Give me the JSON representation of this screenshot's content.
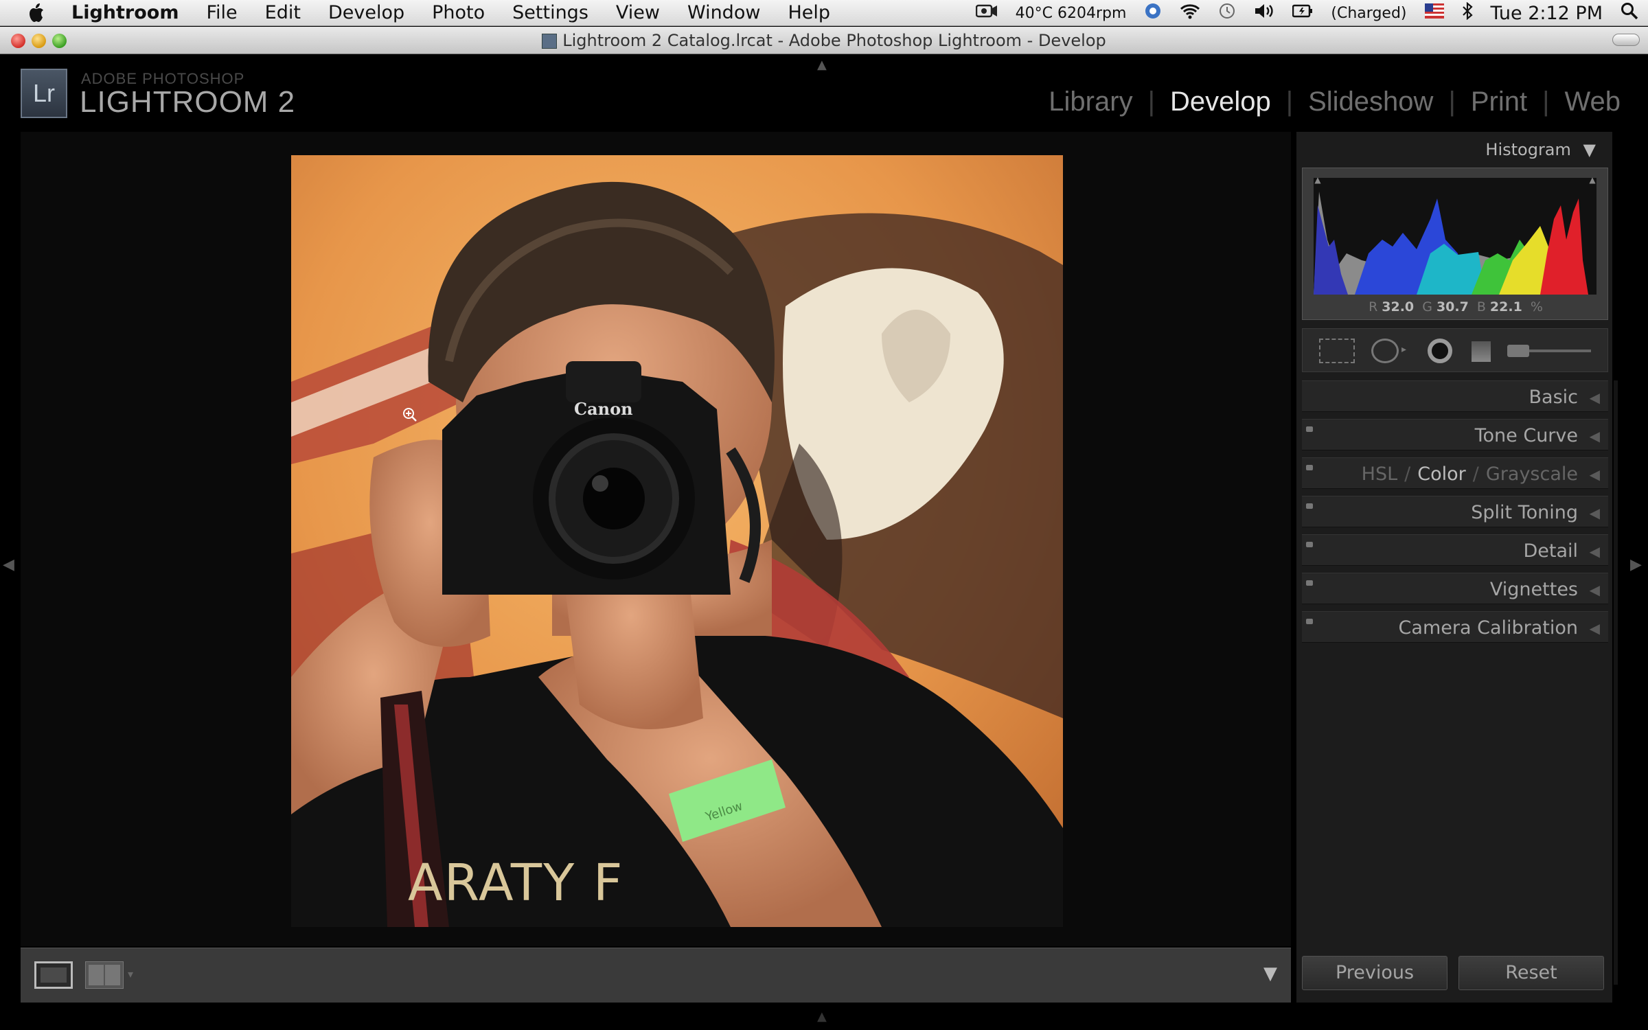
{
  "menubar": {
    "app_name": "Lightroom",
    "items": [
      "File",
      "Edit",
      "Develop",
      "Photo",
      "Settings",
      "View",
      "Window",
      "Help"
    ],
    "status": {
      "temp": "40°C 6204rpm",
      "battery": "(Charged)",
      "clock": "Tue 2:12 PM"
    }
  },
  "window": {
    "title": "Lightroom 2 Catalog.lrcat - Adobe Photoshop Lightroom - Develop"
  },
  "identity": {
    "badge": "Lr",
    "top": "ADOBE PHOTOSHOP",
    "main": "LIGHTROOM 2"
  },
  "modules": {
    "items": [
      "Library",
      "Develop",
      "Slideshow",
      "Print",
      "Web"
    ],
    "active": "Develop"
  },
  "histogram": {
    "label": "Histogram",
    "readout": {
      "r_label": "R",
      "r_value": "32.0",
      "g_label": "G",
      "g_value": "30.7",
      "b_label": "B",
      "b_value": "22.1",
      "unit": "%"
    }
  },
  "panels": {
    "basic": "Basic",
    "tone_curve": "Tone Curve",
    "hsl": "HSL",
    "color": "Color",
    "grayscale": "Grayscale",
    "split_toning": "Split Toning",
    "detail": "Detail",
    "vignettes": "Vignettes",
    "camera_calibration": "Camera Calibration"
  },
  "buttons": {
    "previous": "Previous",
    "reset": "Reset"
  },
  "photo": {
    "camera_brand": "Canon",
    "shirt_text": "ARATY F",
    "wristband_text": "Yellow"
  },
  "colors": {
    "active_module": "#e6e6e6",
    "inactive_module": "#6f6f6f",
    "panel_bg": "#1c1c1c"
  }
}
